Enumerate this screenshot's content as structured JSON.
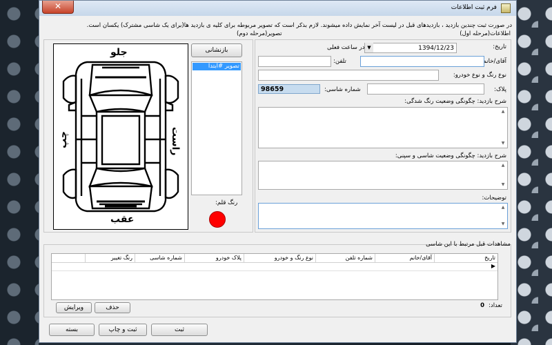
{
  "window": {
    "title": "فرم ثبت اطلاعات",
    "close_glyph": "✕"
  },
  "notice": {
    "line1": "در صورت ثبت چندین بازدید ، بازدیدهای قبل در لیست آخر نمایش داده میشوند. لازم بذکر است که تصویر مربوطه برای کلیه ی بازدید ها(برای یک شاسی مشترک) یکسان است.",
    "phase1": "اطلاعات(مرحله اول)",
    "phase2": "تصویر(مرحله دوم)"
  },
  "form": {
    "date_label": "تاریخ:",
    "date_value": "1394/12/23",
    "time_label": "در ساعت فعلی",
    "owner_label": "آقای/خانم:",
    "owner_value": "",
    "phone_label": "تلفن:",
    "phone_value": "",
    "color_type_label": "نوع رنگ و نوع خودرو:",
    "color_type_value": "",
    "plate_label": "پلاک:",
    "plate_value": "",
    "chassis_label": "شماره شاسی:",
    "chassis_value": "98659",
    "desc_paint_label": "شرح بازدید: چگونگی وضعیت رنگ شدگی:",
    "desc_chassis_label": "شرح بازدید: چگونگی وضعیت شاسی و سپنی:",
    "notes_label": "توضیحات:"
  },
  "image_panel": {
    "review_button": "بازنشانی",
    "list_items": [
      "تصویر #ابتدا"
    ],
    "front_label": "جلو",
    "back_label": "عقب",
    "right_label": "راست",
    "left_label": "چپ",
    "pen_color_label": "رنگ قلم:",
    "pen_color": "#ff0000"
  },
  "history": {
    "title": "مشاهدات قبل مرتبط با این شاسی",
    "columns": [
      "تاریخ",
      "آقای/خانم",
      "شماره تلفن",
      "نوع رنگ و خودرو",
      "پلاک خودرو",
      "شماره شاسی",
      "رنگ تغییر"
    ],
    "row_marker": "▶",
    "count_label": "تعداد:",
    "count_value": "0",
    "delete_button": "حذف",
    "edit_button": "ویرایش"
  },
  "footer": {
    "close_button": "بسته",
    "save_print_button": "ثبت و چاپ",
    "save_button": "ثبت"
  }
}
